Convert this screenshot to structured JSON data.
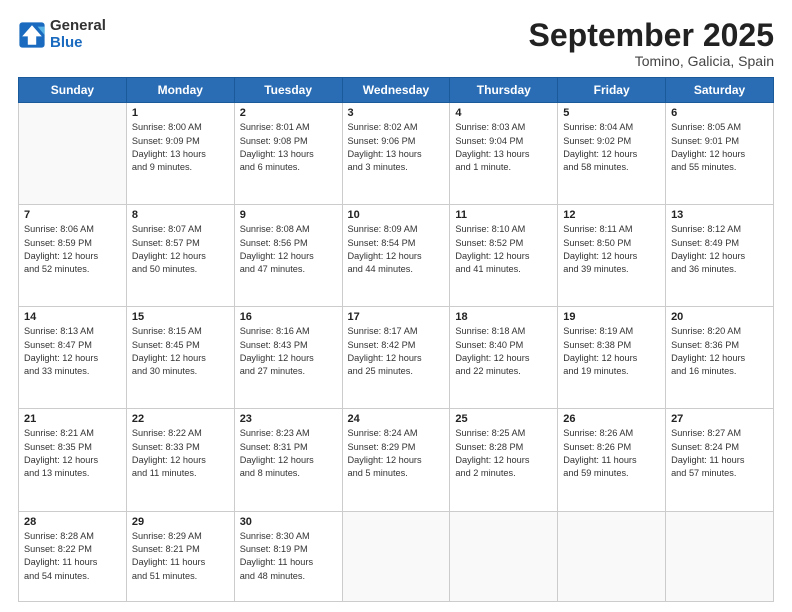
{
  "header": {
    "logo_line1": "General",
    "logo_line2": "Blue",
    "month_title": "September 2025",
    "location": "Tomino, Galicia, Spain"
  },
  "weekdays": [
    "Sunday",
    "Monday",
    "Tuesday",
    "Wednesday",
    "Thursday",
    "Friday",
    "Saturday"
  ],
  "weeks": [
    [
      {
        "day": "",
        "info": ""
      },
      {
        "day": "1",
        "info": "Sunrise: 8:00 AM\nSunset: 9:09 PM\nDaylight: 13 hours\nand 9 minutes."
      },
      {
        "day": "2",
        "info": "Sunrise: 8:01 AM\nSunset: 9:08 PM\nDaylight: 13 hours\nand 6 minutes."
      },
      {
        "day": "3",
        "info": "Sunrise: 8:02 AM\nSunset: 9:06 PM\nDaylight: 13 hours\nand 3 minutes."
      },
      {
        "day": "4",
        "info": "Sunrise: 8:03 AM\nSunset: 9:04 PM\nDaylight: 13 hours\nand 1 minute."
      },
      {
        "day": "5",
        "info": "Sunrise: 8:04 AM\nSunset: 9:02 PM\nDaylight: 12 hours\nand 58 minutes."
      },
      {
        "day": "6",
        "info": "Sunrise: 8:05 AM\nSunset: 9:01 PM\nDaylight: 12 hours\nand 55 minutes."
      }
    ],
    [
      {
        "day": "7",
        "info": "Sunrise: 8:06 AM\nSunset: 8:59 PM\nDaylight: 12 hours\nand 52 minutes."
      },
      {
        "day": "8",
        "info": "Sunrise: 8:07 AM\nSunset: 8:57 PM\nDaylight: 12 hours\nand 50 minutes."
      },
      {
        "day": "9",
        "info": "Sunrise: 8:08 AM\nSunset: 8:56 PM\nDaylight: 12 hours\nand 47 minutes."
      },
      {
        "day": "10",
        "info": "Sunrise: 8:09 AM\nSunset: 8:54 PM\nDaylight: 12 hours\nand 44 minutes."
      },
      {
        "day": "11",
        "info": "Sunrise: 8:10 AM\nSunset: 8:52 PM\nDaylight: 12 hours\nand 41 minutes."
      },
      {
        "day": "12",
        "info": "Sunrise: 8:11 AM\nSunset: 8:50 PM\nDaylight: 12 hours\nand 39 minutes."
      },
      {
        "day": "13",
        "info": "Sunrise: 8:12 AM\nSunset: 8:49 PM\nDaylight: 12 hours\nand 36 minutes."
      }
    ],
    [
      {
        "day": "14",
        "info": "Sunrise: 8:13 AM\nSunset: 8:47 PM\nDaylight: 12 hours\nand 33 minutes."
      },
      {
        "day": "15",
        "info": "Sunrise: 8:15 AM\nSunset: 8:45 PM\nDaylight: 12 hours\nand 30 minutes."
      },
      {
        "day": "16",
        "info": "Sunrise: 8:16 AM\nSunset: 8:43 PM\nDaylight: 12 hours\nand 27 minutes."
      },
      {
        "day": "17",
        "info": "Sunrise: 8:17 AM\nSunset: 8:42 PM\nDaylight: 12 hours\nand 25 minutes."
      },
      {
        "day": "18",
        "info": "Sunrise: 8:18 AM\nSunset: 8:40 PM\nDaylight: 12 hours\nand 22 minutes."
      },
      {
        "day": "19",
        "info": "Sunrise: 8:19 AM\nSunset: 8:38 PM\nDaylight: 12 hours\nand 19 minutes."
      },
      {
        "day": "20",
        "info": "Sunrise: 8:20 AM\nSunset: 8:36 PM\nDaylight: 12 hours\nand 16 minutes."
      }
    ],
    [
      {
        "day": "21",
        "info": "Sunrise: 8:21 AM\nSunset: 8:35 PM\nDaylight: 12 hours\nand 13 minutes."
      },
      {
        "day": "22",
        "info": "Sunrise: 8:22 AM\nSunset: 8:33 PM\nDaylight: 12 hours\nand 11 minutes."
      },
      {
        "day": "23",
        "info": "Sunrise: 8:23 AM\nSunset: 8:31 PM\nDaylight: 12 hours\nand 8 minutes."
      },
      {
        "day": "24",
        "info": "Sunrise: 8:24 AM\nSunset: 8:29 PM\nDaylight: 12 hours\nand 5 minutes."
      },
      {
        "day": "25",
        "info": "Sunrise: 8:25 AM\nSunset: 8:28 PM\nDaylight: 12 hours\nand 2 minutes."
      },
      {
        "day": "26",
        "info": "Sunrise: 8:26 AM\nSunset: 8:26 PM\nDaylight: 11 hours\nand 59 minutes."
      },
      {
        "day": "27",
        "info": "Sunrise: 8:27 AM\nSunset: 8:24 PM\nDaylight: 11 hours\nand 57 minutes."
      }
    ],
    [
      {
        "day": "28",
        "info": "Sunrise: 8:28 AM\nSunset: 8:22 PM\nDaylight: 11 hours\nand 54 minutes."
      },
      {
        "day": "29",
        "info": "Sunrise: 8:29 AM\nSunset: 8:21 PM\nDaylight: 11 hours\nand 51 minutes."
      },
      {
        "day": "30",
        "info": "Sunrise: 8:30 AM\nSunset: 8:19 PM\nDaylight: 11 hours\nand 48 minutes."
      },
      {
        "day": "",
        "info": ""
      },
      {
        "day": "",
        "info": ""
      },
      {
        "day": "",
        "info": ""
      },
      {
        "day": "",
        "info": ""
      }
    ]
  ]
}
